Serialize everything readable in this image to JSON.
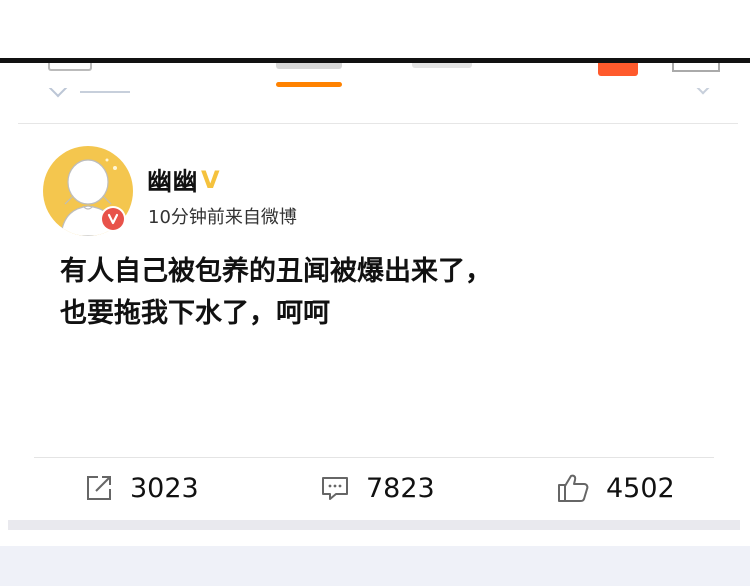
{
  "colors": {
    "tab_indicator": "#ff8200",
    "avatar_bg": "#f4c64e",
    "vip_badge": "#f5c23d",
    "verified_badge": "#e8524a",
    "footer_band": "#eff1f8"
  },
  "post": {
    "username": "幽幽",
    "vip_mark": "V",
    "meta": "10分钟前来自微博",
    "body_lines": [
      "有人自己被包养的丑闻被爆出来了，",
      "也要拖我下水了，呵呵"
    ],
    "avatar_icon": "cartoon-figure-avatar",
    "verified_icon": "verified-v-badge-icon"
  },
  "actions": {
    "repost": {
      "icon": "share-icon",
      "count": "3023"
    },
    "comment": {
      "icon": "comment-icon",
      "count": "7823"
    },
    "like": {
      "icon": "thumbs-up-icon",
      "count": "4502"
    }
  }
}
